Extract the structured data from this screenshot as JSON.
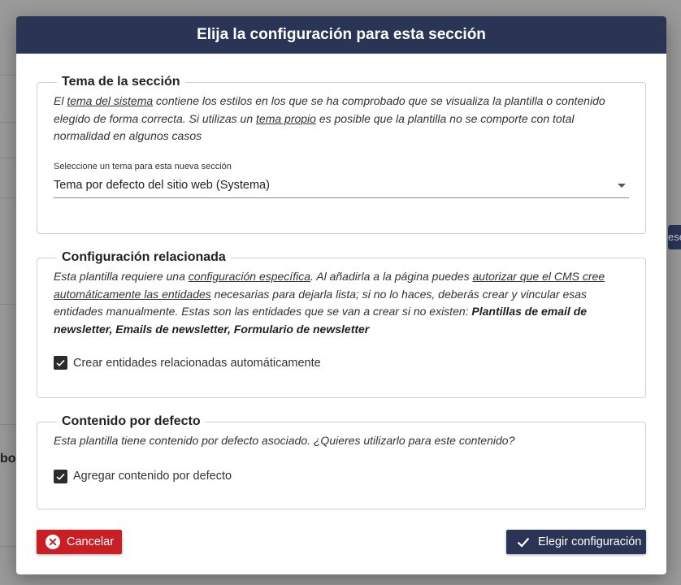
{
  "background": {
    "fragment_bold": "bo",
    "side_tab": "ese"
  },
  "modal": {
    "title": "Elija la configuración para esta sección"
  },
  "theme_section": {
    "legend": "Tema de la sección",
    "desc": {
      "p1": "El ",
      "link1": "tema del sistema",
      "p2": " contiene los estilos en los que se ha comprobado que se visualiza la plantilla o contenido elegido de forma correcta. Si utilizas un ",
      "link2": "tema propio",
      "p3": " es posible que la plantilla no se comporte con total normalidad en algunos casos"
    },
    "select_label": "Seleccione un tema para esta nueva sección",
    "select_value": "Tema por defecto del sitio web (Systema)"
  },
  "related_section": {
    "legend": "Configuración relacionada",
    "desc": {
      "p1": "Esta plantilla requiere una ",
      "link1": "configuración específica",
      "p2": ". Al añadirla a la página puedes ",
      "link2": "autorizar que el CMS cree automáticamente las entidades",
      "p3": " necesarias para dejarla lista; si no lo haces, deberás crear y vincular esas entidades manualmente. Estas son las entidades que se van a crear si no existen: ",
      "entities": "Plantillas de email de newsletter, Emails de newsletter, Formulario de newsletter"
    },
    "checkbox_label": "Crear entidades relacionadas automáticamente",
    "checkbox_checked": true
  },
  "default_content_section": {
    "legend": "Contenido por defecto",
    "desc": "Esta plantilla tiene contenido por defecto asociado. ¿Quieres utilizarlo para este contenido?",
    "checkbox_label": "Agregar contenido por defecto",
    "checkbox_checked": true
  },
  "buttons": {
    "cancel_label": "Cancelar",
    "confirm_label": "Elegir configuración"
  },
  "icons": {
    "cancel": "close-circle-icon",
    "confirm": "check-icon",
    "checkbox": "checkmark-icon",
    "select": "caret-down-icon"
  },
  "colors": {
    "header_bg": "#2a3556",
    "cancel_bg": "#c81e24",
    "confirm_bg": "#2a3556",
    "checkbox_bg": "#2b2b2b",
    "overlay_bg": "#9a9a9a"
  }
}
